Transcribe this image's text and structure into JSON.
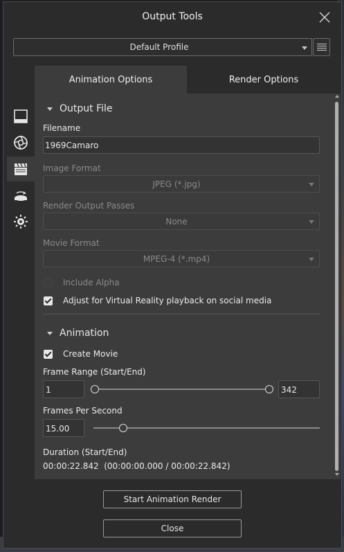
{
  "window": {
    "title": "Output Tools"
  },
  "profile": {
    "selected": "Default Profile"
  },
  "sidebar": {
    "items": [
      {
        "icon": "frame-icon"
      },
      {
        "icon": "aperture-icon"
      },
      {
        "icon": "clapperboard-icon"
      },
      {
        "icon": "turntable-icon"
      },
      {
        "icon": "sun-gear-icon"
      }
    ]
  },
  "tabs": {
    "animation": "Animation Options",
    "render": "Render Options"
  },
  "output_file": {
    "header": "Output File",
    "filename_label": "Filename",
    "filename_value": "1969Camaro",
    "image_format_label": "Image Format",
    "image_format_value": "JPEG (*.jpg)",
    "render_passes_label": "Render Output Passes",
    "render_passes_value": "None",
    "movie_format_label": "Movie Format",
    "movie_format_value": "MPEG-4 (*.mp4)",
    "include_alpha_label": "Include Alpha",
    "include_alpha_checked": false,
    "vr_label": "Adjust for Virtual Reality playback on social media",
    "vr_checked": true
  },
  "animation": {
    "header": "Animation",
    "create_movie_label": "Create Movie",
    "create_movie_checked": true,
    "frame_range_label": "Frame Range (Start/End)",
    "frame_start": "1",
    "frame_end": "342",
    "fps_label": "Frames Per Second",
    "fps_value": "15.00",
    "duration_label": "Duration (Start/End)",
    "duration_value": "00:00:22.842  (00:00:00.000 / 00:00:22.842)"
  },
  "buttons": {
    "start": "Start Animation Render",
    "close": "Close"
  }
}
